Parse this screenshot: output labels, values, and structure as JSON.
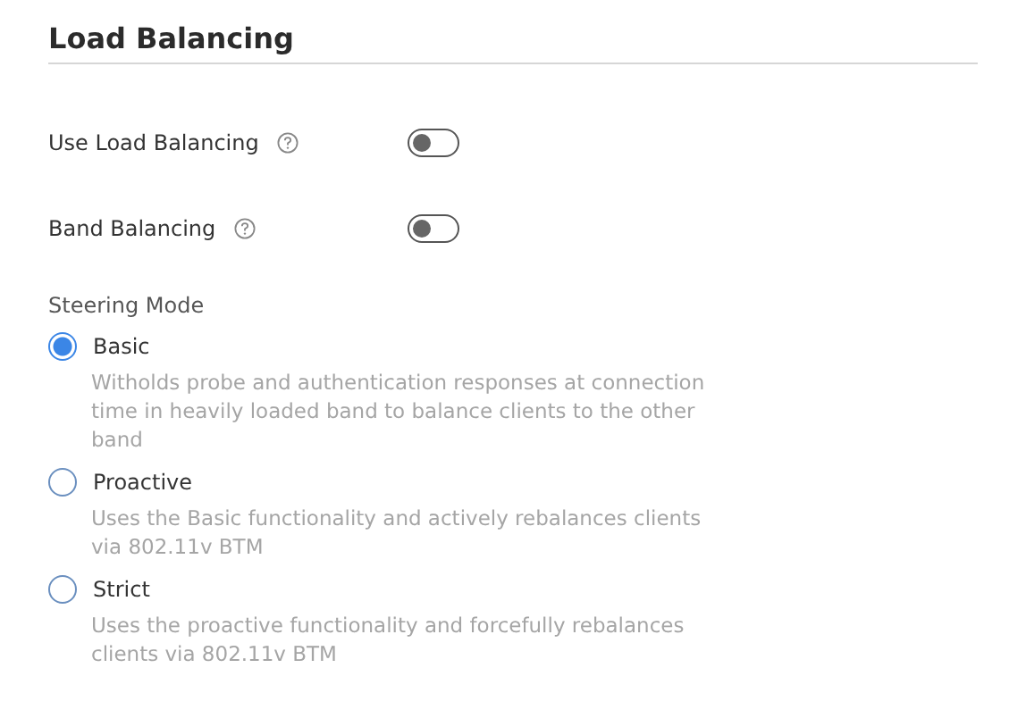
{
  "title": "Load Balancing",
  "toggles": [
    {
      "label": "Use Load Balancing",
      "on": false
    },
    {
      "label": "Band Balancing",
      "on": false
    }
  ],
  "steering_mode": {
    "label": "Steering Mode",
    "options": [
      {
        "label": "Basic",
        "selected": true,
        "description": "Witholds probe and authentication responses at connection time in heavily loaded band to balance clients to the other band"
      },
      {
        "label": "Proactive",
        "selected": false,
        "description": "Uses the Basic functionality and actively rebalances clients via 802.11v BTM"
      },
      {
        "label": "Strict",
        "selected": false,
        "description": "Uses the proactive functionality and forcefully rebalances clients via 802.11v BTM"
      }
    ]
  }
}
